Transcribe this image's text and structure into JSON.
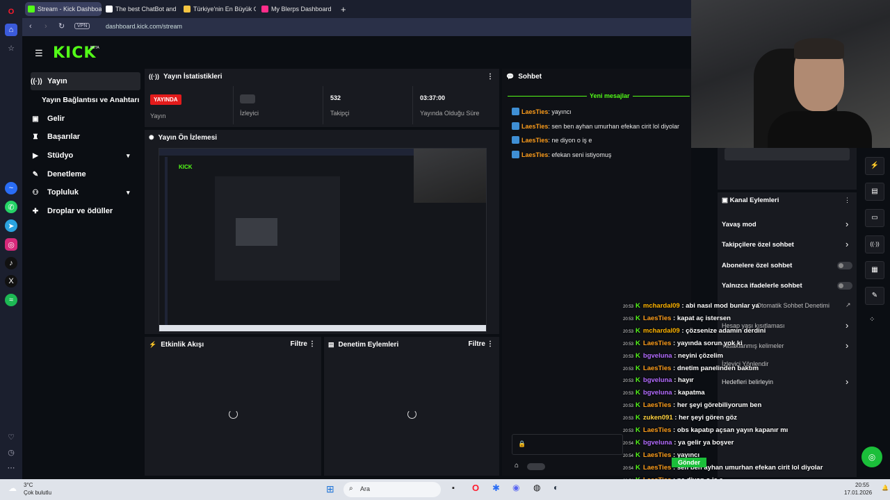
{
  "browser": {
    "tabs": [
      {
        "label": "Stream - Kick Dashboard",
        "fav_color": "#53fc18"
      },
      {
        "label": "The best ChatBot and Wi",
        "fav_color": "#ffffff"
      },
      {
        "label": "Türkiye'nin En Büyük Oyu",
        "fav_color": "#f4c542"
      },
      {
        "label": "My Blerps Dashboard",
        "fav_color": "#ff2d8a"
      }
    ],
    "add_tab": "+",
    "vpn": "VPN",
    "url": "dashboard.kick.com/stream"
  },
  "kick": {
    "logo": "KICK",
    "beta": "BETA",
    "nav": [
      {
        "label": "Yayın",
        "icon": "broadcast-icon"
      },
      {
        "label": "Yayın Bağlantısı ve Anahtarı",
        "icon": ""
      },
      {
        "label": "Gelir",
        "icon": "wallet-icon"
      },
      {
        "label": "Başarılar",
        "icon": "trophy-icon"
      },
      {
        "label": "Stüdyo",
        "icon": "video-icon"
      },
      {
        "label": "Denetleme",
        "icon": "wrench-icon"
      },
      {
        "label": "Topluluk",
        "icon": "users-icon"
      },
      {
        "label": "Droplar ve ödüller",
        "icon": "gift-icon"
      }
    ],
    "stats": {
      "title": "Yayın İstatistikleri",
      "live_badge": "YAYINDA",
      "items": [
        {
          "label": "Yayın",
          "value": ""
        },
        {
          "label": "İzleyici",
          "value": ""
        },
        {
          "label": "Takipçi",
          "value": "532"
        },
        {
          "label": "Yayında Olduğu Süre",
          "value": "03:37:00"
        }
      ]
    },
    "preview_title": "Yayın Ön İzlemesi",
    "activity": {
      "title": "Etkinlik Akışı",
      "filter": "Filtre"
    },
    "moderation": {
      "title": "Denetim Eylemleri",
      "filter": "Filtre"
    },
    "chat": {
      "title": "Sohbet",
      "new_messages": "Yeni mesajlar",
      "messages": [
        {
          "user": "LaesTies",
          "text": ": yayıncı"
        },
        {
          "user": "LaesTies",
          "text": ": sen ben ayhan umurhan efekan cirit lol diyolar"
        },
        {
          "user": "LaesTies",
          "text": ": ne diyon o iş e"
        },
        {
          "user": "LaesTies",
          "text": ": efekan seni istiyomuş"
        }
      ],
      "send": "Gönder"
    },
    "channel_actions": {
      "title": "Kanal Eylemleri",
      "items": [
        "Yavaş mod",
        "Takipçilere özel sohbet",
        "Abonelere özel sohbet",
        "Yalnızca ifadelerle sohbet"
      ],
      "more": [
        "Otomatik Sohbet Denetimi",
        "Hesap yaşı kısıtlaması",
        "Yasaklanmış kelimeler",
        "İzleyici Yönlendir",
        "Hedefleri belirleyin"
      ]
    }
  },
  "overlay_chat": [
    {
      "time": "20:53",
      "user": "mchardal09",
      "text": " : abi nasıl mod bunlar ya",
      "color": "#ffb400"
    },
    {
      "time": "20:53",
      "user": "LaesTies",
      "text": " : kapat aç istersen",
      "color": "#ff9e1b"
    },
    {
      "time": "20:53",
      "user": "mchardal09",
      "text": " : çözsenize adamın derdini",
      "color": "#ffb400"
    },
    {
      "time": "20:53",
      "user": "LaesTies",
      "text": " : yayında sorun yok ki",
      "color": "#ff9e1b"
    },
    {
      "time": "20:53",
      "user": "bgveluna",
      "text": " : neyini çözelim",
      "color": "#b36bff"
    },
    {
      "time": "20:53",
      "user": "LaesTies",
      "text": " : dnetim panelinden baktım",
      "color": "#ff9e1b"
    },
    {
      "time": "20:53",
      "user": "bgveluna",
      "text": " : hayır",
      "color": "#b36bff"
    },
    {
      "time": "20:53",
      "user": "bgveluna",
      "text": " : kapatma",
      "color": "#b36bff"
    },
    {
      "time": "20:53",
      "user": "LaesTies",
      "text": " : her şeyi görebiliyorum ben",
      "color": "#ff9e1b"
    },
    {
      "time": "20:53",
      "user": "zuken091",
      "text": " : her şeyi gören göz",
      "color": "#ffd23f"
    },
    {
      "time": "20:53",
      "user": "LaesTies",
      "text": " : obs kapatıp açsan yayın kapanır mı",
      "color": "#ff9e1b"
    },
    {
      "time": "20:54",
      "user": "bgveluna",
      "text": " : ya gelir ya boşver",
      "color": "#b36bff"
    },
    {
      "time": "20:54",
      "user": "LaesTies",
      "text": " : yayıncı",
      "color": "#ff9e1b"
    },
    {
      "time": "20:54",
      "user": "LaesTies",
      "text": " : sen ben ayhan umurhan efekan cirit lol diyolar",
      "color": "#ff9e1b"
    },
    {
      "time": "20:54",
      "user": "LaesTies",
      "text": " : ne diyon o iş e",
      "color": "#ff9e1b"
    },
    {
      "time": "20:54",
      "user": "LaesTies",
      "text": " : efekan seni istiyomuş",
      "color": "#ff9e1b"
    }
  ],
  "taskbar": {
    "weather_temp": "3°C",
    "weather_desc": "Çok bulutlu",
    "search": "Ara",
    "time": "20:55",
    "date": "17.01.2026"
  }
}
